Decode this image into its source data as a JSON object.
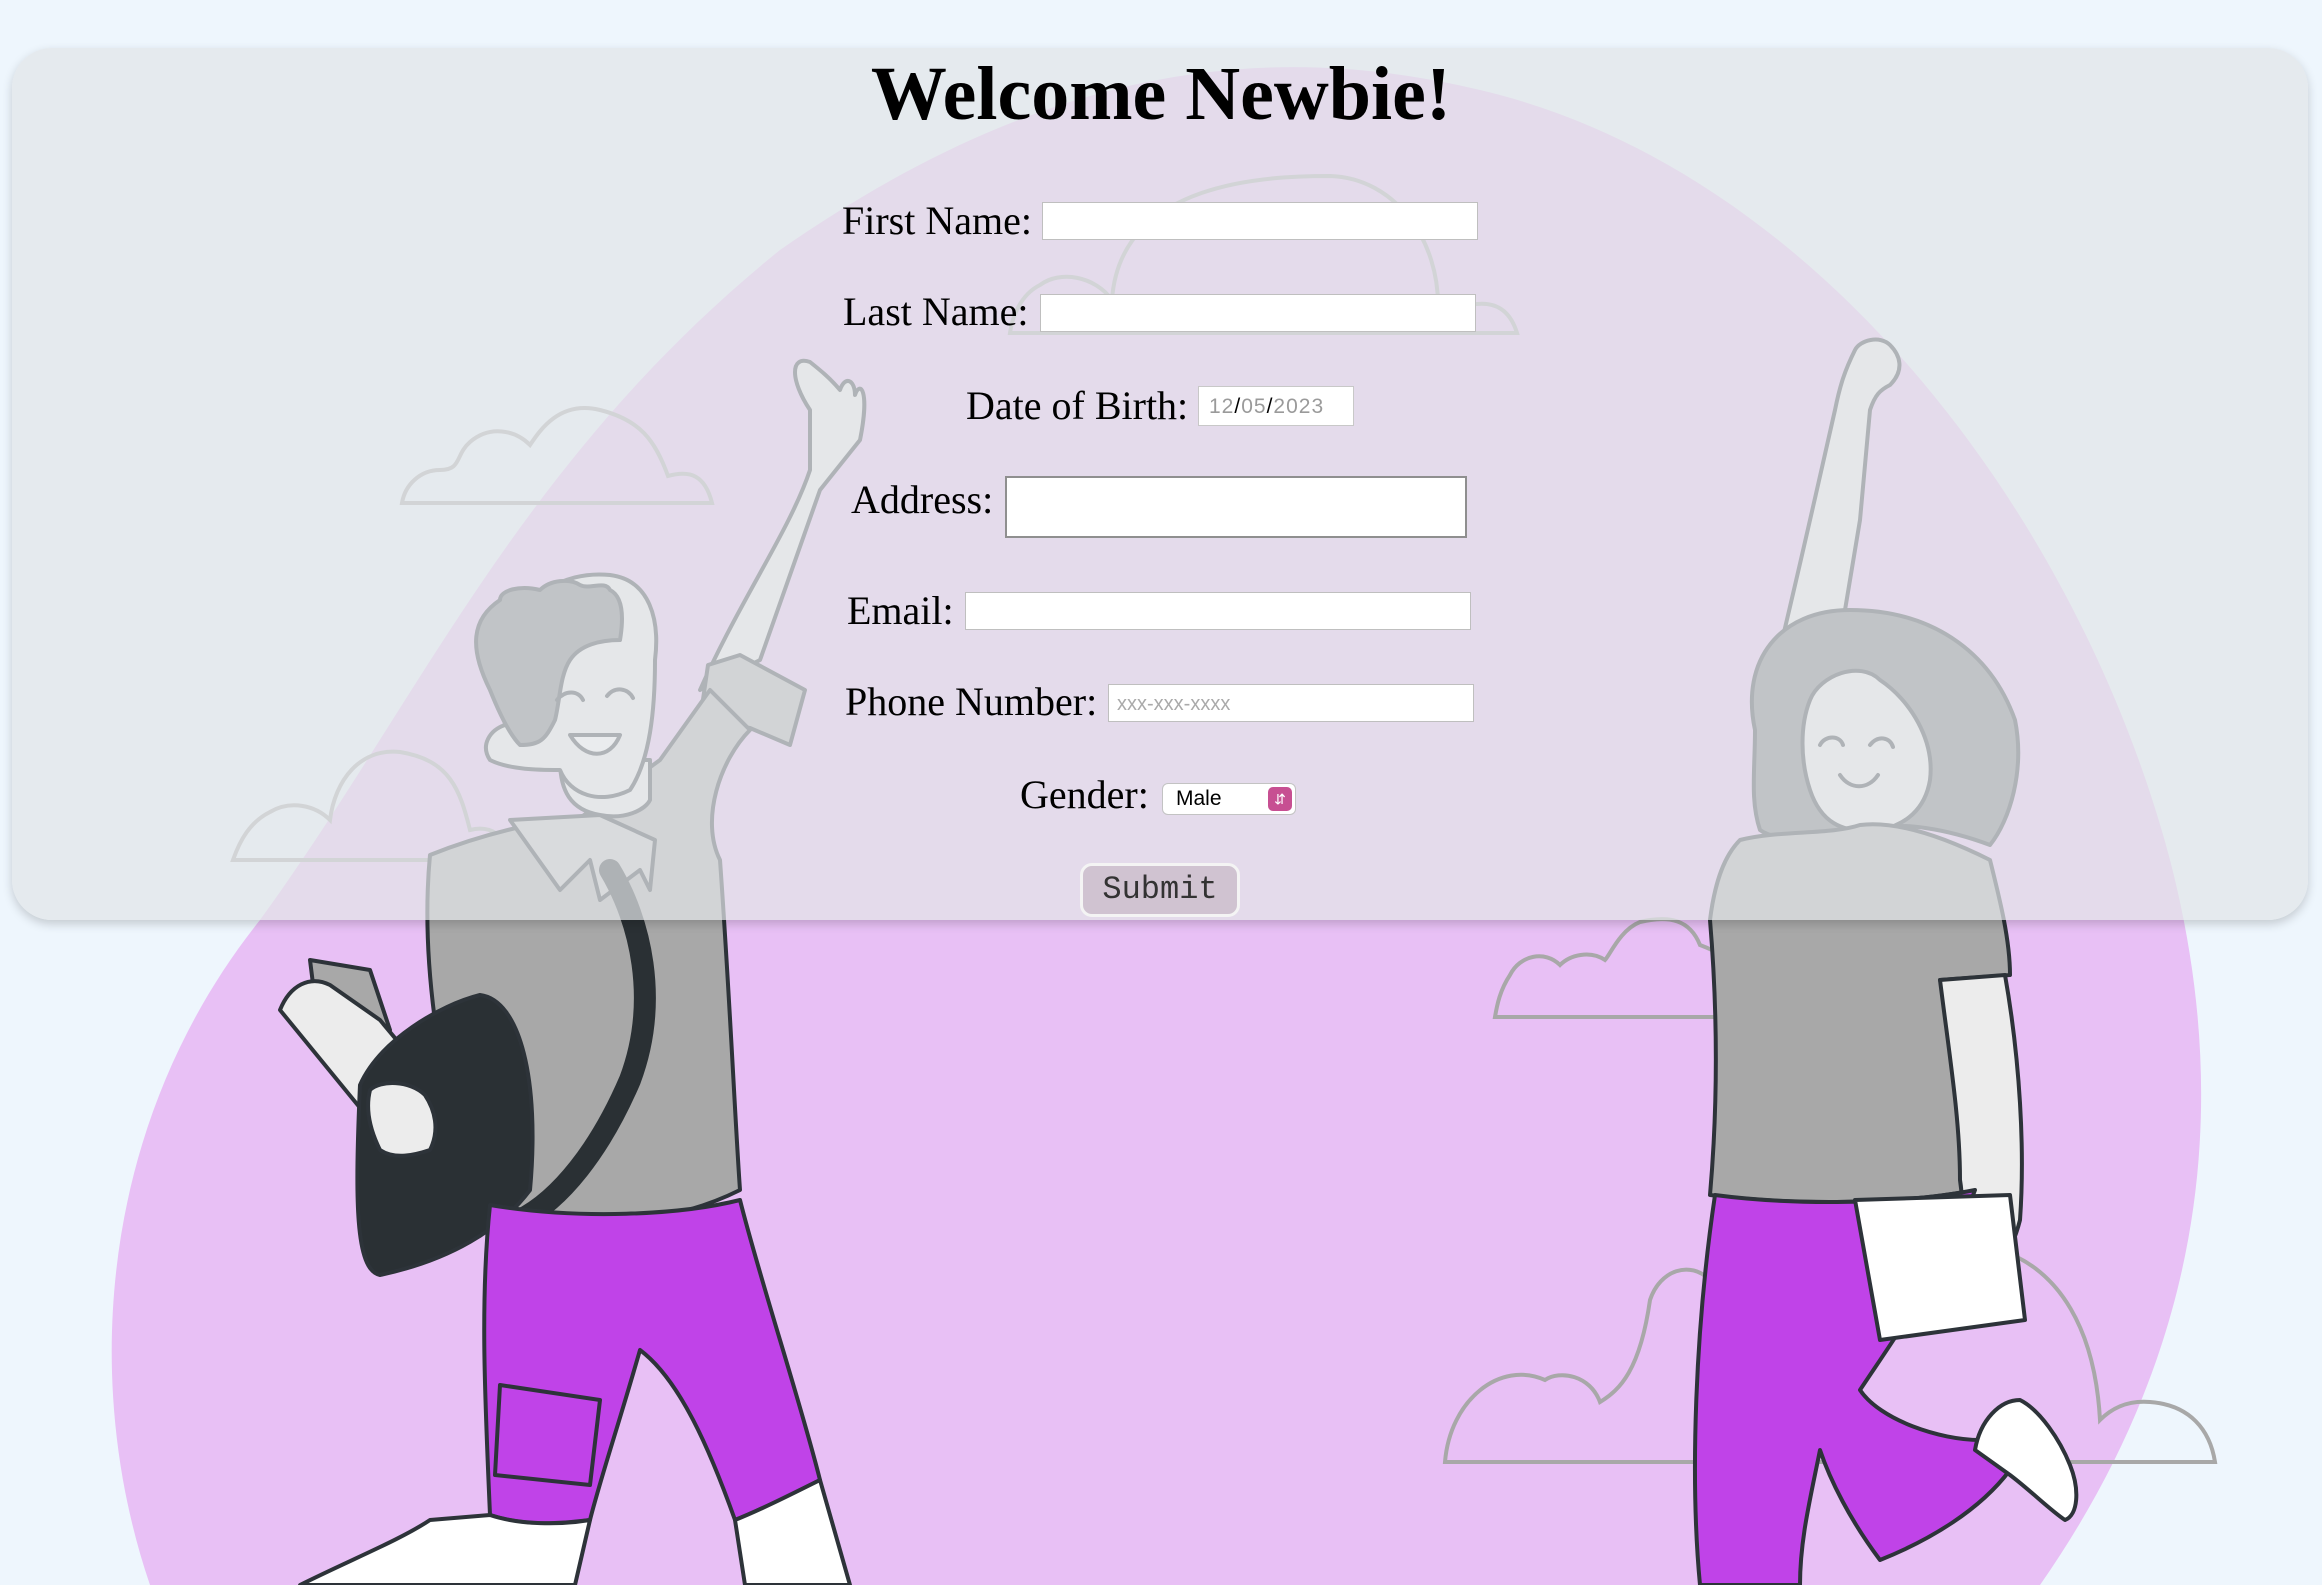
{
  "page": {
    "title": "Welcome Newbie!"
  },
  "form": {
    "first_name_label": "First Name:",
    "first_name_value": "",
    "last_name_label": "Last Name:",
    "last_name_value": "",
    "dob_label": "Date of Birth:",
    "dob_month": "12",
    "dob_day": "05",
    "dob_year": "2023",
    "dob_separator": "/",
    "address_label": "Address:",
    "address_value": "",
    "email_label": "Email:",
    "email_value": "",
    "phone_label": "Phone Number:",
    "phone_placeholder": "xxx-xxx-xxxx",
    "gender_label": "Gender:",
    "gender_selected": "Male",
    "submit_label": "Submit"
  },
  "colors": {
    "background": "#eef6fd",
    "blob": "#e8c0f5",
    "panel": "#e2e4e8",
    "pants": "#c043e8",
    "select_accent": "#c74f92"
  },
  "icons": {
    "select_arrows": "select-arrows-icon"
  }
}
